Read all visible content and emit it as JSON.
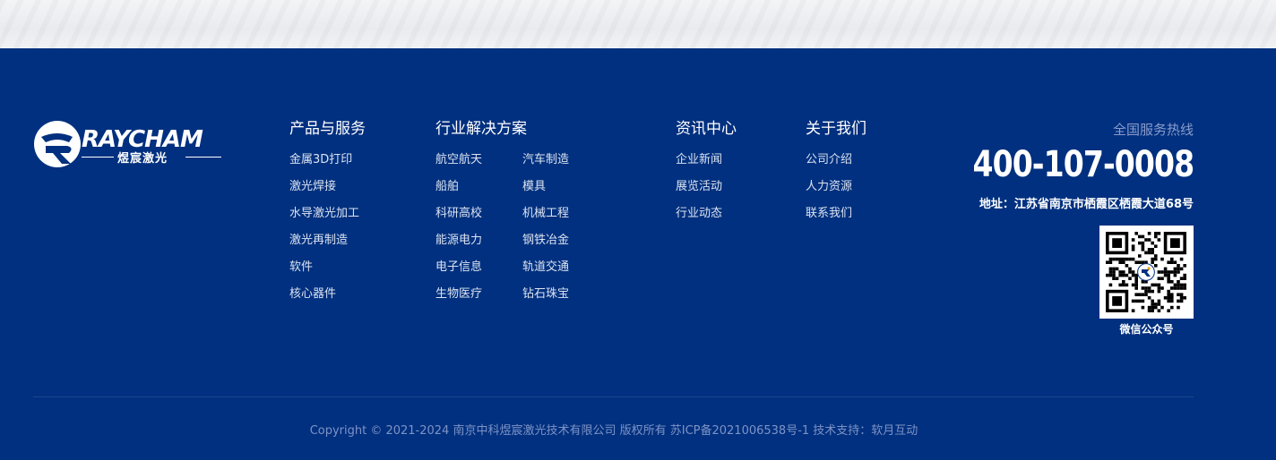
{
  "brand": {
    "name": "RAYCHAM",
    "sub": "煜宸激光"
  },
  "nav": [
    {
      "title": "产品与服务",
      "items": [
        "金属3D打印",
        "激光焊接",
        "水导激光加工",
        "激光再制造",
        "软件",
        "核心器件"
      ]
    },
    {
      "title": "行业解决方案",
      "items_left": [
        "航空航天",
        "船舶",
        "科研高校",
        "能源电力",
        "电子信息",
        "生物医疗"
      ],
      "items_right": [
        "汽车制造",
        "模具",
        "机械工程",
        "钢铁冶金",
        "轨道交通",
        "钻石珠宝"
      ]
    },
    {
      "title": "资讯中心",
      "items": [
        "企业新闻",
        "展览活动",
        "行业动态"
      ]
    },
    {
      "title": "关于我们",
      "items": [
        "公司介绍",
        "人力资源",
        "联系我们"
      ]
    }
  ],
  "contact": {
    "hotline_label": "全国服务热线",
    "hotline_number": "400-107-0008",
    "address": "地址：江苏省南京市栖霞区栖霞大道68号",
    "qr_label": "微信公众号"
  },
  "copyright": "Copyright © 2021-2024 南京中科煜宸激光技术有限公司 版权所有 苏ICP备2021006538号-1 技术支持：软月互动",
  "colors": {
    "footer_bg": "#00307f",
    "muted_text": "#7e93c6"
  }
}
